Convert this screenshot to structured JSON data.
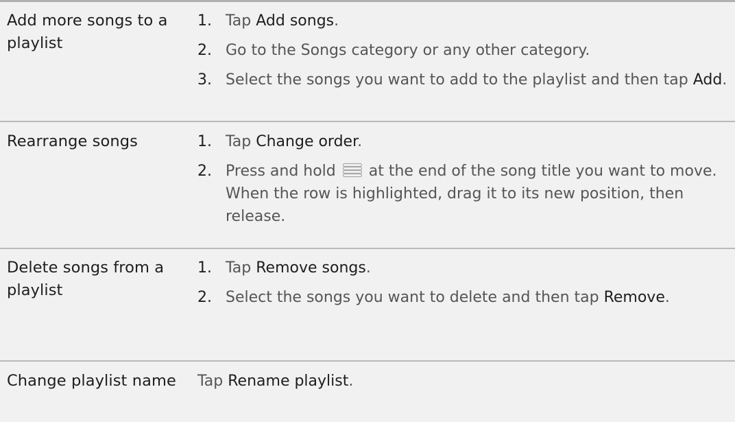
{
  "rows": [
    {
      "action": "Add more songs to a playlist",
      "steps": [
        {
          "num": "1.",
          "pre": "Tap ",
          "em": "Add songs",
          "post": "."
        },
        {
          "num": "2.",
          "pre": "Go to the Songs category or any other category.",
          "em": "",
          "post": ""
        },
        {
          "num": "3.",
          "pre": "Select the songs you want to add to the playlist and then tap ",
          "em": "Add",
          "post": "."
        }
      ]
    },
    {
      "action": "Rearrange songs",
      "steps": [
        {
          "num": "1.",
          "pre": "Tap ",
          "em": "Change order",
          "post": "."
        },
        {
          "num": "2.",
          "pre": "Press and hold",
          "icon": "drag-handle-icon",
          "post": "at the end of the song title you want to move. When the row is highlighted, drag it to its new position, then release."
        }
      ]
    },
    {
      "action": "Delete songs from a playlist",
      "steps": [
        {
          "num": "1.",
          "pre": "Tap ",
          "em": "Remove songs",
          "post": "."
        },
        {
          "num": "2.",
          "pre": "Select the songs you want to delete and then tap ",
          "em": "Remove",
          "post": "."
        }
      ]
    },
    {
      "action": "Change playlist name",
      "single": {
        "pre": "Tap ",
        "em": "Rename playlist",
        "post": "."
      }
    }
  ]
}
